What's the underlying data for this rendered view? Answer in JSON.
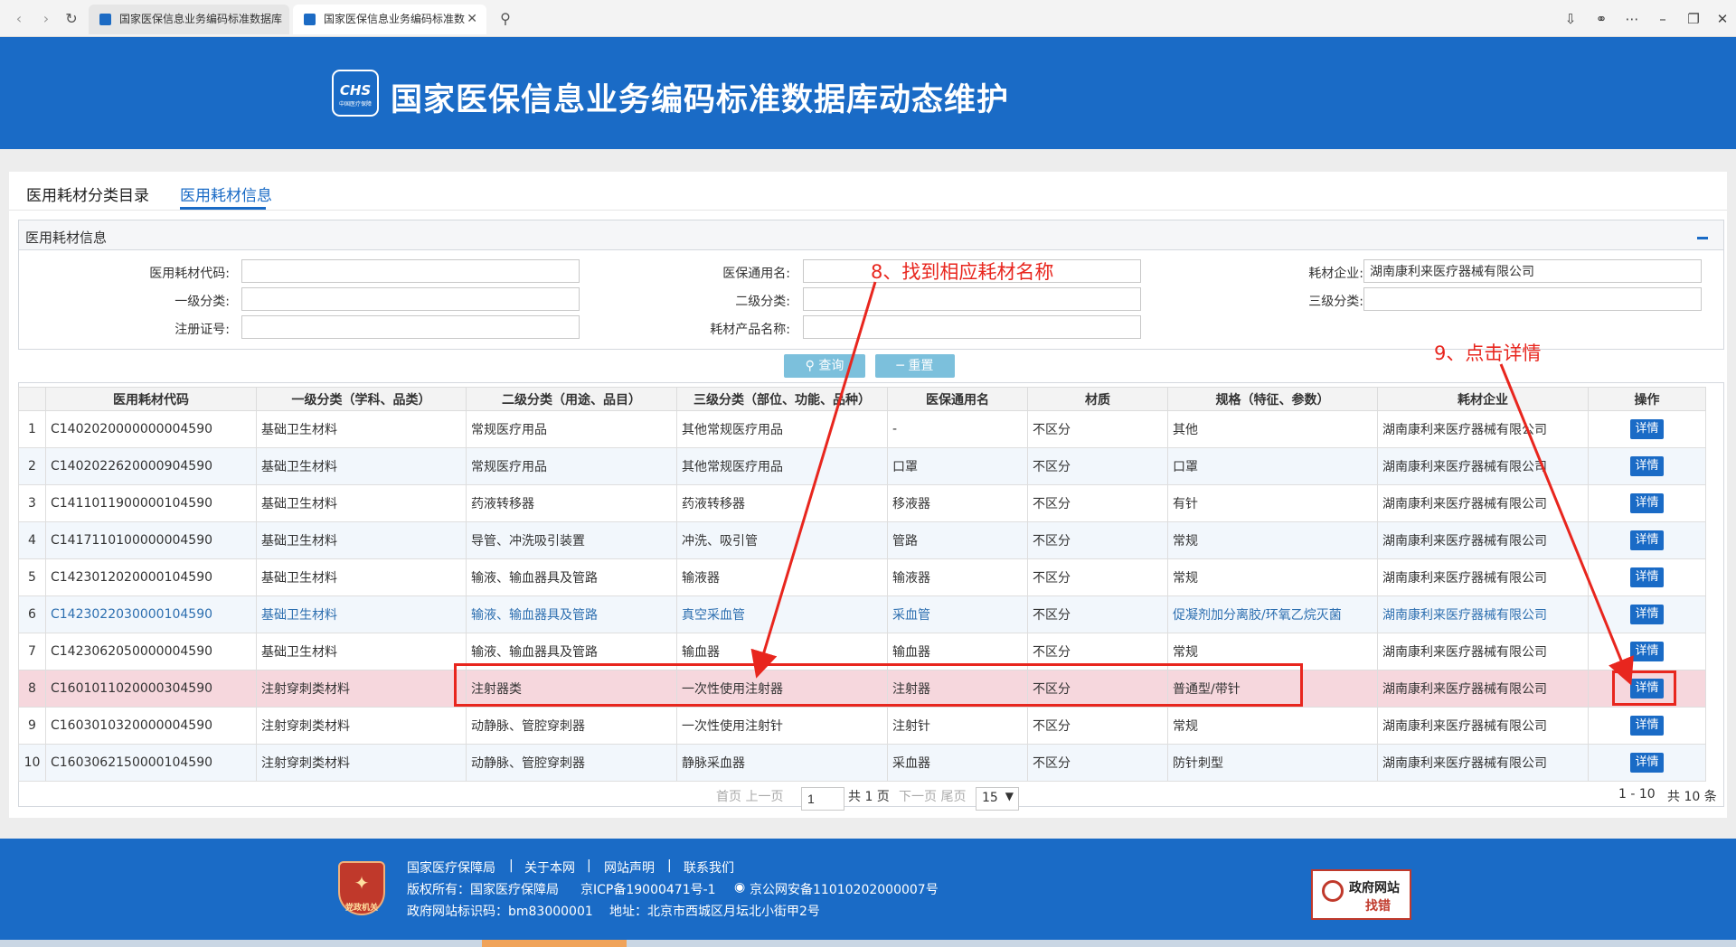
{
  "browser": {
    "tabs": [
      {
        "label": "国家医保信息业务编码标准数据库"
      },
      {
        "label": "国家医保信息业务编码标准数"
      }
    ]
  },
  "header": {
    "logo_text": "CHS",
    "logo_sub": "中国医疗保障",
    "title": "国家医保信息业务编码标准数据库动态维护"
  },
  "main_tabs": [
    {
      "label": "医用耗材分类目录"
    },
    {
      "label": "医用耗材信息"
    }
  ],
  "section_title": "医用耗材信息",
  "filters": {
    "code_label": "医用耗材代码:",
    "code_value": "",
    "generic_label": "医保通用名:",
    "generic_value": "",
    "company_label": "耗材企业:",
    "company_value": "湖南康利来医疗器械有限公司",
    "cat1_label": "一级分类:",
    "cat1_value": "",
    "cat2_label": "二级分类:",
    "cat2_value": "",
    "cat3_label": "三级分类:",
    "cat3_value": "",
    "reg_label": "注册证号:",
    "reg_value": "",
    "product_label": "耗材产品名称:",
    "product_value": ""
  },
  "buttons": {
    "search": "查询",
    "reset": "重置"
  },
  "table": {
    "headers": [
      "医用耗材代码",
      "一级分类（学科、品类）",
      "二级分类（用途、品目）",
      "三级分类（部位、功能、品种）",
      "医保通用名",
      "材质",
      "规格（特征、参数）",
      "耗材企业",
      "操作"
    ],
    "detail_label": "详情",
    "rows": [
      {
        "no": "1",
        "code": "C1402020000000004590",
        "cat1": "基础卫生材料",
        "cat2": "常规医疗用品",
        "cat3": "其他常规医疗用品",
        "generic": "-",
        "material": "不区分",
        "spec": "其他",
        "company": "湖南康利来医疗器械有限公司"
      },
      {
        "no": "2",
        "code": "C1402022620000904590",
        "cat1": "基础卫生材料",
        "cat2": "常规医疗用品",
        "cat3": "其他常规医疗用品",
        "generic": "口罩",
        "material": "不区分",
        "spec": "口罩",
        "company": "湖南康利来医疗器械有限公司"
      },
      {
        "no": "3",
        "code": "C1411011900000104590",
        "cat1": "基础卫生材料",
        "cat2": "药液转移器",
        "cat3": "药液转移器",
        "generic": "移液器",
        "material": "不区分",
        "spec": "有针",
        "company": "湖南康利来医疗器械有限公司"
      },
      {
        "no": "4",
        "code": "C1417110100000004590",
        "cat1": "基础卫生材料",
        "cat2": "导管、冲洗吸引装置",
        "cat3": "冲洗、吸引管",
        "generic": "管路",
        "material": "不区分",
        "spec": "常规",
        "company": "湖南康利来医疗器械有限公司"
      },
      {
        "no": "5",
        "code": "C1423012020000104590",
        "cat1": "基础卫生材料",
        "cat2": "输液、输血器具及管路",
        "cat3": "输液器",
        "generic": "输液器",
        "material": "不区分",
        "spec": "常规",
        "company": "湖南康利来医疗器械有限公司"
      },
      {
        "no": "6",
        "code": "C1423022030000104590",
        "cat1": "基础卫生材料",
        "cat2": "输液、输血器具及管路",
        "cat3": "真空采血管",
        "generic": "采血管",
        "material": "不区分",
        "spec": "促凝剂加分离胶/环氧乙烷灭菌",
        "company": "湖南康利来医疗器械有限公司"
      },
      {
        "no": "7",
        "code": "C1423062050000004590",
        "cat1": "基础卫生材料",
        "cat2": "输液、输血器具及管路",
        "cat3": "输血器",
        "generic": "输血器",
        "material": "不区分",
        "spec": "常规",
        "company": "湖南康利来医疗器械有限公司"
      },
      {
        "no": "8",
        "code": "C1601011020000304590",
        "cat1": "注射穿刺类材料",
        "cat2": "注射器类",
        "cat3": "一次性使用注射器",
        "generic": "注射器",
        "material": "不区分",
        "spec": "普通型/带针",
        "company": "湖南康利来医疗器械有限公司"
      },
      {
        "no": "9",
        "code": "C1603010320000004590",
        "cat1": "注射穿刺类材料",
        "cat2": "动静脉、管腔穿刺器",
        "cat3": "一次性使用注射针",
        "generic": "注射针",
        "material": "不区分",
        "spec": "常规",
        "company": "湖南康利来医疗器械有限公司"
      },
      {
        "no": "10",
        "code": "C1603062150000104590",
        "cat1": "注射穿刺类材料",
        "cat2": "动静脉、管腔穿刺器",
        "cat3": "静脉采血器",
        "generic": "采血器",
        "material": "不区分",
        "spec": "防针刺型",
        "company": "湖南康利来医疗器械有限公司"
      }
    ]
  },
  "pager": {
    "first_prev": "首页 上一页",
    "page_value": "1",
    "total_pages": "共 1 页",
    "next_last": "下一页 尾页",
    "page_size": "15",
    "range": "1 - 10",
    "total": "共 10 条"
  },
  "annotations": {
    "step8": "8、找到相应耗材名称",
    "step9": "9、点击详情",
    "color": "#e8261e"
  },
  "footer": {
    "emblem_text": "党政机关",
    "links": [
      "国家医疗保障局",
      "关于本网",
      "网站声明",
      "联系我们"
    ],
    "sep": "|",
    "copyright": "版权所有：国家医疗保障局",
    "icp": "京ICP备19000471号-1",
    "police": "京公网安备11010202000007号",
    "site_code": "政府网站标识码：bm83000001",
    "address": "地址：北京市西城区月坛北小街甲2号",
    "report_line1": "政府网站",
    "report_line2": "找错"
  },
  "colors": {
    "brand_blue": "#1a6bc6",
    "highlight_row": "#f6d7dd",
    "button_light": "#7cc0dc"
  }
}
